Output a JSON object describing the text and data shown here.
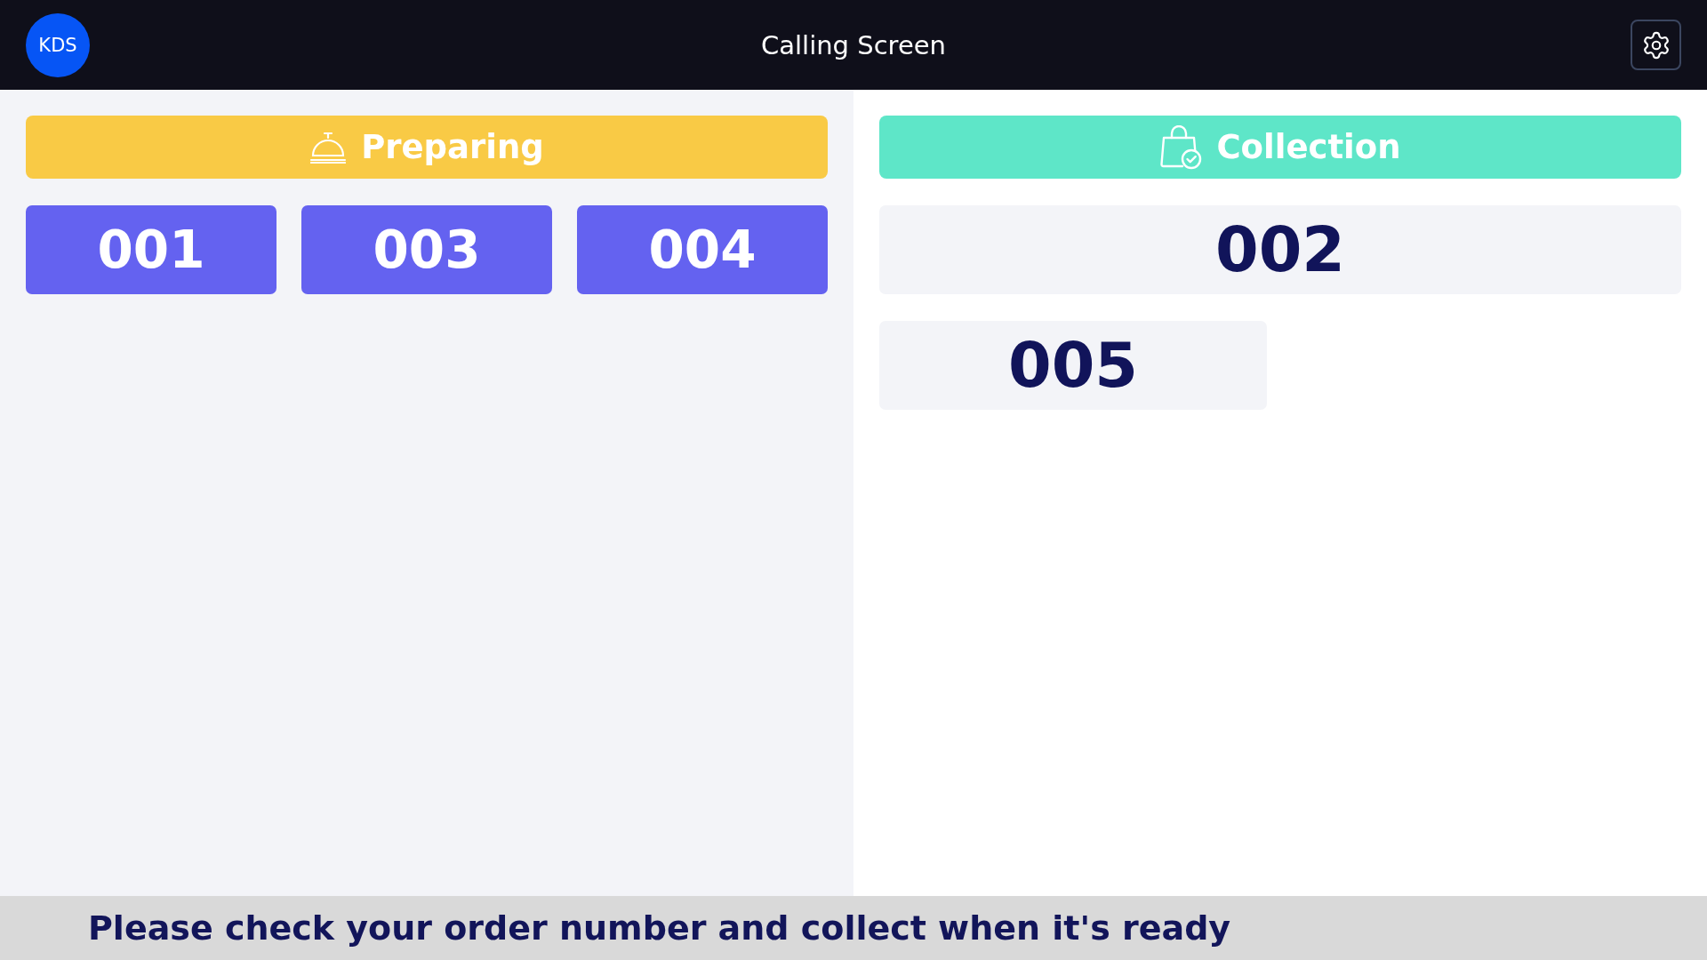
{
  "header": {
    "logo": "KDS",
    "title": "Calling Screen"
  },
  "panels": [
    {
      "kind": "preparing",
      "title": "Preparing",
      "orders": [
        "001",
        "003",
        "004"
      ]
    },
    {
      "kind": "collection",
      "title": "Collection",
      "orders": [
        "002",
        "005"
      ]
    }
  ],
  "footer": {
    "message": "Please check your order number and collect when it's ready"
  }
}
